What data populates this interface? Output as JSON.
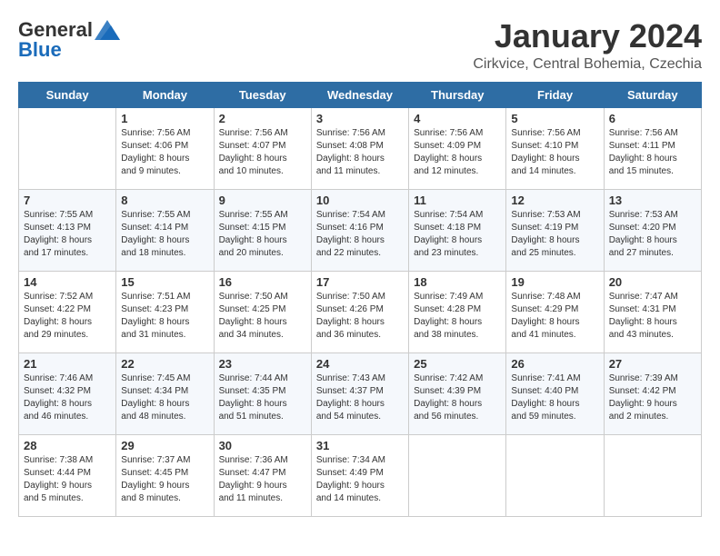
{
  "header": {
    "logo_general": "General",
    "logo_blue": "Blue",
    "month_title": "January 2024",
    "location": "Cirkvice, Central Bohemia, Czechia"
  },
  "days_of_week": [
    "Sunday",
    "Monday",
    "Tuesday",
    "Wednesday",
    "Thursday",
    "Friday",
    "Saturday"
  ],
  "weeks": [
    [
      {
        "day": "",
        "content": ""
      },
      {
        "day": "1",
        "content": "Sunrise: 7:56 AM\nSunset: 4:06 PM\nDaylight: 8 hours\nand 9 minutes."
      },
      {
        "day": "2",
        "content": "Sunrise: 7:56 AM\nSunset: 4:07 PM\nDaylight: 8 hours\nand 10 minutes."
      },
      {
        "day": "3",
        "content": "Sunrise: 7:56 AM\nSunset: 4:08 PM\nDaylight: 8 hours\nand 11 minutes."
      },
      {
        "day": "4",
        "content": "Sunrise: 7:56 AM\nSunset: 4:09 PM\nDaylight: 8 hours\nand 12 minutes."
      },
      {
        "day": "5",
        "content": "Sunrise: 7:56 AM\nSunset: 4:10 PM\nDaylight: 8 hours\nand 14 minutes."
      },
      {
        "day": "6",
        "content": "Sunrise: 7:56 AM\nSunset: 4:11 PM\nDaylight: 8 hours\nand 15 minutes."
      }
    ],
    [
      {
        "day": "7",
        "content": "Sunrise: 7:55 AM\nSunset: 4:13 PM\nDaylight: 8 hours\nand 17 minutes."
      },
      {
        "day": "8",
        "content": "Sunrise: 7:55 AM\nSunset: 4:14 PM\nDaylight: 8 hours\nand 18 minutes."
      },
      {
        "day": "9",
        "content": "Sunrise: 7:55 AM\nSunset: 4:15 PM\nDaylight: 8 hours\nand 20 minutes."
      },
      {
        "day": "10",
        "content": "Sunrise: 7:54 AM\nSunset: 4:16 PM\nDaylight: 8 hours\nand 22 minutes."
      },
      {
        "day": "11",
        "content": "Sunrise: 7:54 AM\nSunset: 4:18 PM\nDaylight: 8 hours\nand 23 minutes."
      },
      {
        "day": "12",
        "content": "Sunrise: 7:53 AM\nSunset: 4:19 PM\nDaylight: 8 hours\nand 25 minutes."
      },
      {
        "day": "13",
        "content": "Sunrise: 7:53 AM\nSunset: 4:20 PM\nDaylight: 8 hours\nand 27 minutes."
      }
    ],
    [
      {
        "day": "14",
        "content": "Sunrise: 7:52 AM\nSunset: 4:22 PM\nDaylight: 8 hours\nand 29 minutes."
      },
      {
        "day": "15",
        "content": "Sunrise: 7:51 AM\nSunset: 4:23 PM\nDaylight: 8 hours\nand 31 minutes."
      },
      {
        "day": "16",
        "content": "Sunrise: 7:50 AM\nSunset: 4:25 PM\nDaylight: 8 hours\nand 34 minutes."
      },
      {
        "day": "17",
        "content": "Sunrise: 7:50 AM\nSunset: 4:26 PM\nDaylight: 8 hours\nand 36 minutes."
      },
      {
        "day": "18",
        "content": "Sunrise: 7:49 AM\nSunset: 4:28 PM\nDaylight: 8 hours\nand 38 minutes."
      },
      {
        "day": "19",
        "content": "Sunrise: 7:48 AM\nSunset: 4:29 PM\nDaylight: 8 hours\nand 41 minutes."
      },
      {
        "day": "20",
        "content": "Sunrise: 7:47 AM\nSunset: 4:31 PM\nDaylight: 8 hours\nand 43 minutes."
      }
    ],
    [
      {
        "day": "21",
        "content": "Sunrise: 7:46 AM\nSunset: 4:32 PM\nDaylight: 8 hours\nand 46 minutes."
      },
      {
        "day": "22",
        "content": "Sunrise: 7:45 AM\nSunset: 4:34 PM\nDaylight: 8 hours\nand 48 minutes."
      },
      {
        "day": "23",
        "content": "Sunrise: 7:44 AM\nSunset: 4:35 PM\nDaylight: 8 hours\nand 51 minutes."
      },
      {
        "day": "24",
        "content": "Sunrise: 7:43 AM\nSunset: 4:37 PM\nDaylight: 8 hours\nand 54 minutes."
      },
      {
        "day": "25",
        "content": "Sunrise: 7:42 AM\nSunset: 4:39 PM\nDaylight: 8 hours\nand 56 minutes."
      },
      {
        "day": "26",
        "content": "Sunrise: 7:41 AM\nSunset: 4:40 PM\nDaylight: 8 hours\nand 59 minutes."
      },
      {
        "day": "27",
        "content": "Sunrise: 7:39 AM\nSunset: 4:42 PM\nDaylight: 9 hours\nand 2 minutes."
      }
    ],
    [
      {
        "day": "28",
        "content": "Sunrise: 7:38 AM\nSunset: 4:44 PM\nDaylight: 9 hours\nand 5 minutes."
      },
      {
        "day": "29",
        "content": "Sunrise: 7:37 AM\nSunset: 4:45 PM\nDaylight: 9 hours\nand 8 minutes."
      },
      {
        "day": "30",
        "content": "Sunrise: 7:36 AM\nSunset: 4:47 PM\nDaylight: 9 hours\nand 11 minutes."
      },
      {
        "day": "31",
        "content": "Sunrise: 7:34 AM\nSunset: 4:49 PM\nDaylight: 9 hours\nand 14 minutes."
      },
      {
        "day": "",
        "content": ""
      },
      {
        "day": "",
        "content": ""
      },
      {
        "day": "",
        "content": ""
      }
    ]
  ]
}
